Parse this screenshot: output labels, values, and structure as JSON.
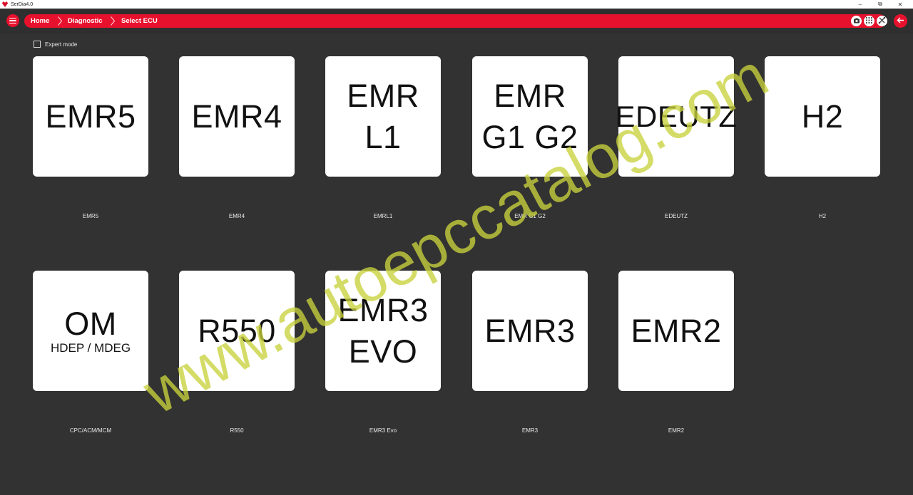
{
  "window": {
    "title": "SerDia4.0",
    "controls": [
      "–",
      "⧉",
      "✕"
    ]
  },
  "breadcrumb": [
    "Home",
    "Diagnostic",
    "Select ECU"
  ],
  "toolbar_icons": [
    "camera-icon",
    "grid-icon",
    "connection-icon",
    "back-arrow-icon"
  ],
  "expert_mode": {
    "label": "Expert mode",
    "checked": false
  },
  "ecus": [
    {
      "lines": [
        "EMR5"
      ],
      "caption": "EMR5"
    },
    {
      "lines": [
        "EMR4"
      ],
      "caption": "EMR4"
    },
    {
      "lines": [
        "EMR",
        "L1"
      ],
      "caption": "EMRL1"
    },
    {
      "lines": [
        "EMR",
        "G1 G2"
      ],
      "caption": "EMR G1 G2"
    },
    {
      "lines": [
        "EDEUTZ"
      ],
      "caption": "EDEUTZ"
    },
    {
      "lines": [
        "H2"
      ],
      "caption": "H2"
    },
    {
      "lines": [
        "OM"
      ],
      "sub": "HDEP / MDEG",
      "caption": "CPC/ACM/MCM"
    },
    {
      "lines": [
        "R550"
      ],
      "caption": "R550"
    },
    {
      "lines": [
        "EMR3",
        "EVO"
      ],
      "caption": "EMR3 Evo"
    },
    {
      "lines": [
        "EMR3"
      ],
      "caption": "EMR3"
    },
    {
      "lines": [
        "EMR2"
      ],
      "caption": "EMR2"
    }
  ],
  "watermark": "www.autoepccatalog.com",
  "colors": {
    "accent": "#e8112d",
    "background": "#323232",
    "watermark": "#c8d23c"
  }
}
